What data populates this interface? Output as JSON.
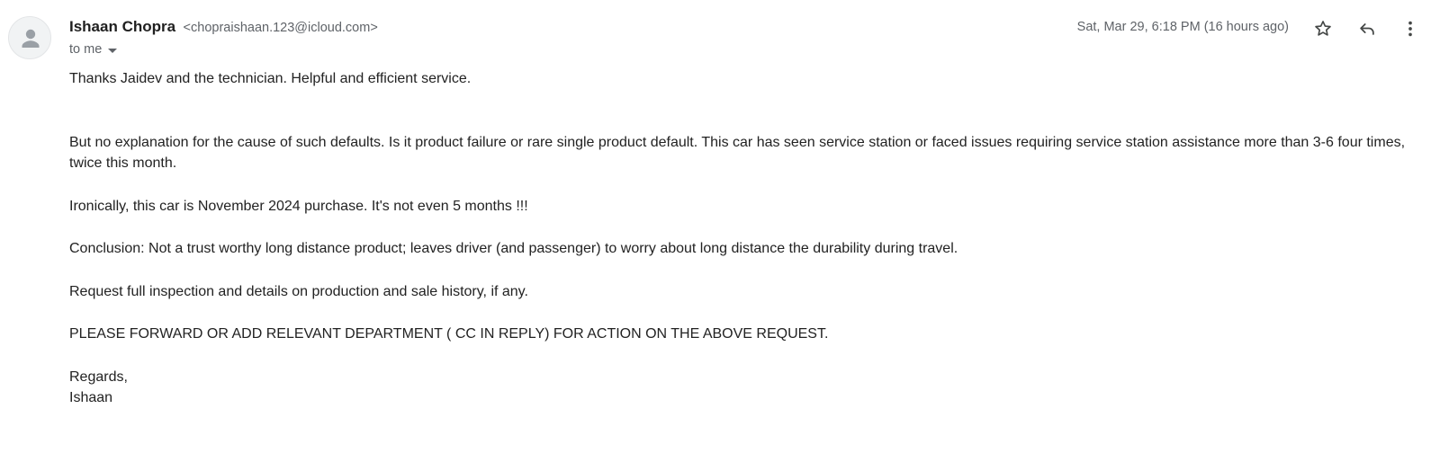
{
  "email": {
    "sender_name": "Ishaan Chopra",
    "sender_email": "<chopraishaan.123@icloud.com>",
    "recipient_label": "to me",
    "timestamp": "Sat, Mar 29, 6:18 PM (16 hours ago)",
    "icons": {
      "avatar": "person-avatar-icon",
      "star": "star-icon",
      "reply": "reply-icon",
      "more": "more-vert-icon",
      "recipients_toggle": "chevron-down-icon"
    },
    "body": {
      "p1": "Thanks Jaidev and the technician. Helpful and efficient service.",
      "p2": "But no explanation for the cause of such defaults. Is it product failure or rare single product default. This car has seen service station or faced issues requiring service station assistance more than 3-6 four times, twice this month.",
      "p3": "Ironically, this car is November 2024 purchase. It's not even 5 months !!!",
      "p4": "Conclusion: Not a trust worthy long distance product; leaves driver (and passenger) to worry about long distance the durability during travel.",
      "p5": "Request full inspection and details on production and sale history, if any.",
      "p6": "PLEASE FORWARD OR ADD RELEVANT DEPARTMENT ( CC IN REPLY) FOR ACTION ON THE ABOVE REQUEST.",
      "closing": "Regards,",
      "signature": "Ishaan"
    }
  }
}
